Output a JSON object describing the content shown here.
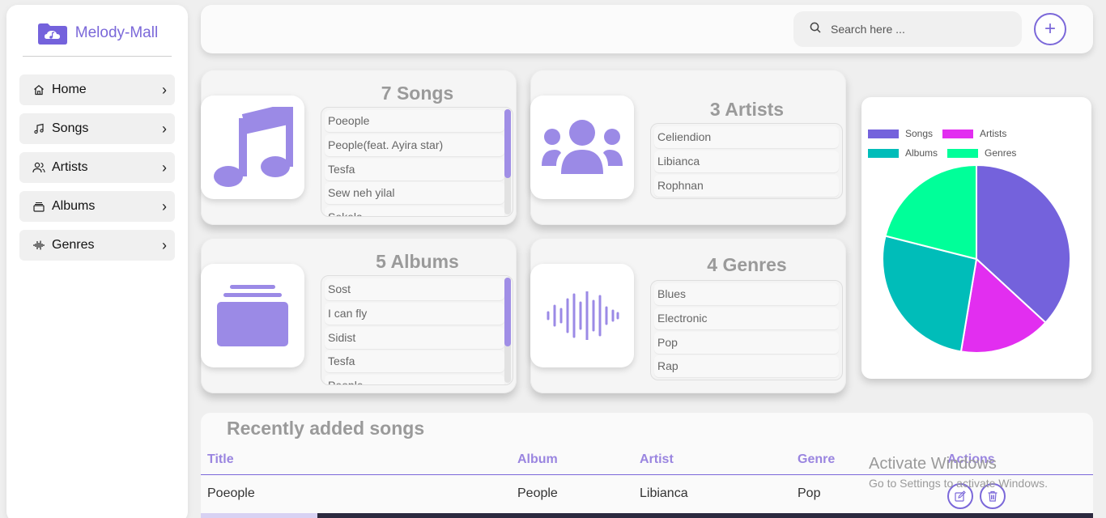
{
  "brand": {
    "name": "Melody-Mall"
  },
  "sidebar": {
    "items": [
      {
        "label": "Home",
        "icon": "home-icon"
      },
      {
        "label": "Songs",
        "icon": "music-note-icon"
      },
      {
        "label": "Artists",
        "icon": "users-icon"
      },
      {
        "label": "Albums",
        "icon": "album-icon"
      },
      {
        "label": "Genres",
        "icon": "waveform-icon"
      }
    ],
    "chevron": "›"
  },
  "topbar": {
    "search_placeholder": "Search here ...",
    "add_label": "+"
  },
  "cards": {
    "songs": {
      "title": "7 Songs",
      "items": [
        "Poeople",
        "People(feat. Ayira star)",
        "Tesfa",
        "Sew neh yilal",
        "Sekela"
      ]
    },
    "artists": {
      "title": "3 Artists",
      "items": [
        "Celiendion",
        "Libianca",
        "Rophnan"
      ]
    },
    "albums": {
      "title": "5 Albums",
      "items": [
        "Sost",
        "I can fly",
        "Sidist",
        "Tesfa",
        "People"
      ]
    },
    "genres": {
      "title": "4 Genres",
      "items": [
        "Blues",
        "Electronic",
        "Pop",
        "Rap"
      ]
    }
  },
  "chart_data": {
    "type": "pie",
    "categories": [
      "Songs",
      "Artists",
      "Albums",
      "Genres"
    ],
    "values": [
      7,
      3,
      5,
      4
    ],
    "colors": [
      "#7462dc",
      "#e22ef0",
      "#00bdb9",
      "#00ff99"
    ],
    "legend": "top"
  },
  "table": {
    "title": "Recently added songs",
    "columns": [
      "Title",
      "Album",
      "Artist",
      "Genre",
      "Actions"
    ],
    "rows": [
      {
        "title": "Poeople",
        "album": "People",
        "artist": "Libianca",
        "genre": "Pop"
      }
    ]
  },
  "watermark": {
    "title": "Activate Windows",
    "subtitle": "Go to Settings to activate Windows."
  },
  "colors": {
    "accent": "#7b68d9",
    "icon_fill": "#9b8ae6"
  }
}
